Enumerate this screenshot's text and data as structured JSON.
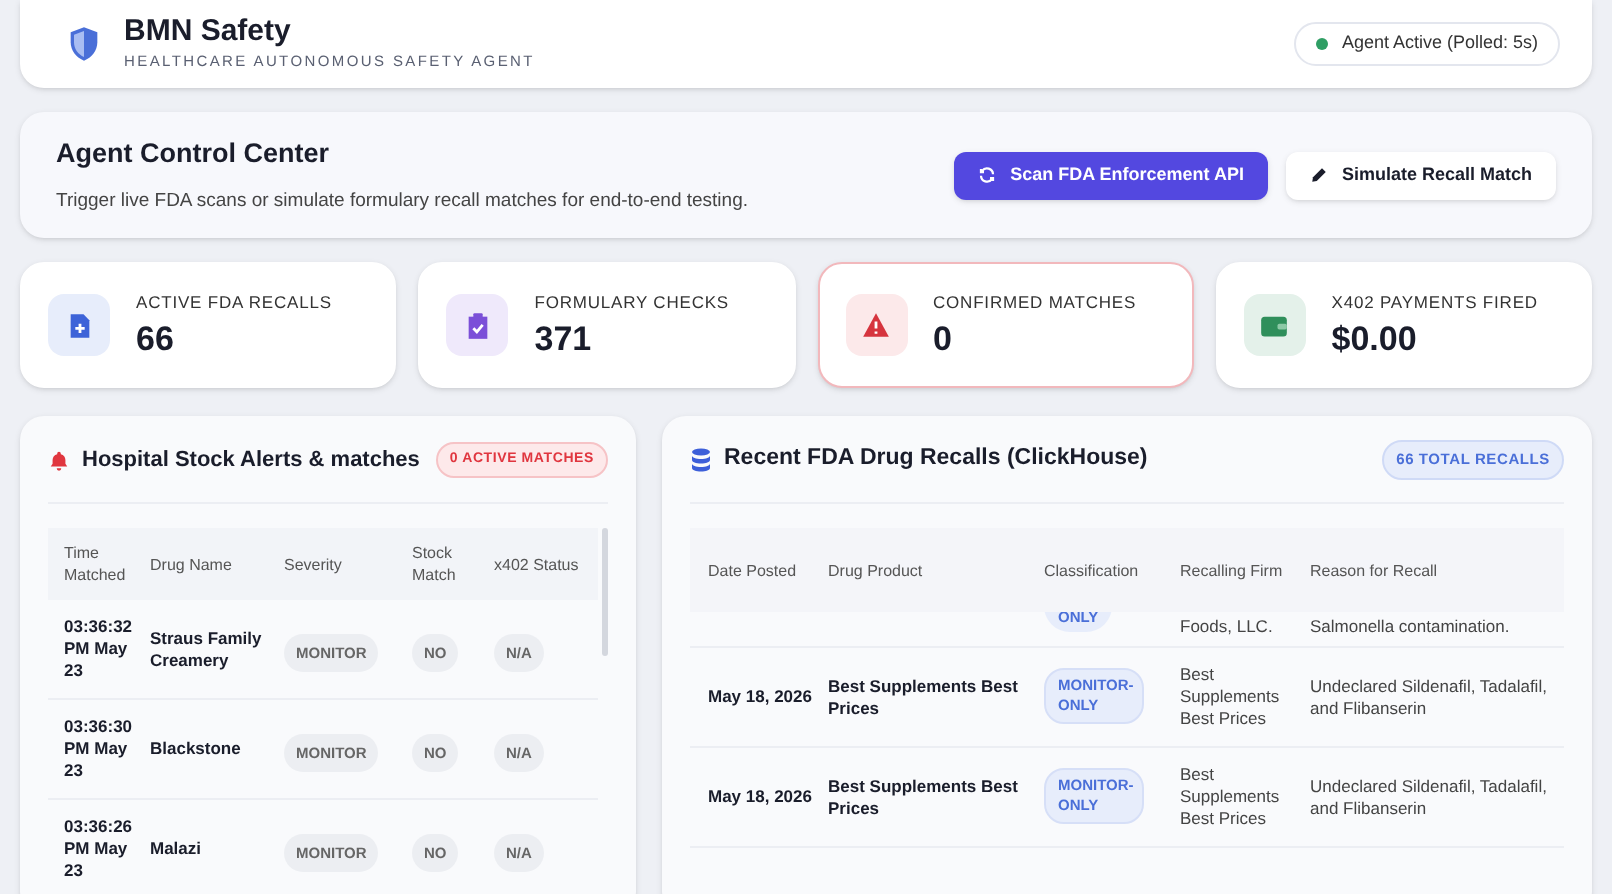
{
  "header": {
    "title": "BMN Safety",
    "subtitle": "HEALTHCARE AUTONOMOUS SAFETY AGENT",
    "status": {
      "label": "Agent Active (Polled: 5s)",
      "active": true
    }
  },
  "control_center": {
    "title": "Agent Control Center",
    "description": "Trigger live FDA scans or simulate formulary recall matches for end-to-end testing.",
    "buttons": [
      {
        "label": "Scan FDA Enforcement API",
        "kind": "primary"
      },
      {
        "label": "Simulate Recall Match",
        "kind": "secondary"
      }
    ]
  },
  "stats": [
    {
      "label": "ACTIVE FDA RECALLS",
      "value": "66",
      "kind": "recalls",
      "highlighted": false
    },
    {
      "label": "FORMULARY CHECKS",
      "value": "371",
      "kind": "checks",
      "highlighted": false
    },
    {
      "label": "CONFIRMED MATCHES",
      "value": "0",
      "kind": "matches",
      "highlighted": true
    },
    {
      "label": "X402 PAYMENTS FIRED",
      "value": "$0.00",
      "kind": "payments",
      "highlighted": false
    }
  ],
  "alerts": {
    "title": "Hospital Stock Alerts & matches",
    "badge": "0 ACTIVE MATCHES",
    "columns": [
      "Time Matched",
      "Drug Name",
      "Severity",
      "Stock Match",
      "x402 Status"
    ],
    "rows": [
      {
        "time": "03:36:32 PM May 23",
        "drug": "Straus Family Creamery",
        "severity": "MONITOR",
        "stock_match": "NO",
        "status": "N/A"
      },
      {
        "time": "03:36:30 PM May 23",
        "drug": "Blackstone",
        "severity": "MONITOR",
        "stock_match": "NO",
        "status": "N/A"
      },
      {
        "time": "03:36:26 PM May 23",
        "drug": "Malazi",
        "severity": "MONITOR",
        "stock_match": "NO",
        "status": "N/A"
      }
    ]
  },
  "recalls": {
    "title": "Recent FDA Drug Recalls (ClickHouse)",
    "badge": "66 TOTAL RECALLS",
    "columns": [
      "Date Posted",
      "Drug Product",
      "Classification",
      "Recalling Firm",
      "Reason for Recall"
    ],
    "partial_row": {
      "classification": "ONLY",
      "firm": "Foods, LLC.",
      "reason": "Salmonella contamination."
    },
    "rows": [
      {
        "date": "May 18, 2026",
        "product": "Best Supplements Best Prices",
        "classification": "MONITOR-ONLY",
        "firm": "Best Supplements Best Prices",
        "reason": "Undeclared Sildenafil, Tadalafil, and Flibanserin"
      },
      {
        "date": "May 18, 2026",
        "product": "Best Supplements Best Prices",
        "classification": "MONITOR-ONLY",
        "firm": "Best Supplements Best Prices",
        "reason": "Undeclared Sildenafil, Tadalafil, and Flibanserin"
      }
    ]
  }
}
